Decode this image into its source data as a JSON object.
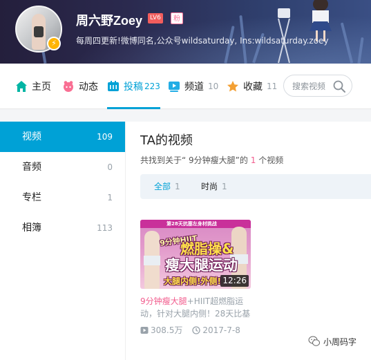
{
  "profile": {
    "name": "周六野Zoey",
    "level": "LV6",
    "fan_badge": "粉",
    "signature": "每周四更新!微博同名,公众号wildsaturday, Ins:wildsaturday.zoey"
  },
  "nav": {
    "tabs": [
      {
        "label": "主页",
        "count": "",
        "icon": "home-icon"
      },
      {
        "label": "动态",
        "count": "",
        "icon": "dynamic-icon"
      },
      {
        "label": "投稿",
        "count": "223",
        "icon": "upload-icon"
      },
      {
        "label": "频道",
        "count": "10",
        "icon": "channel-icon"
      },
      {
        "label": "收藏",
        "count": "11",
        "icon": "favorite-icon"
      }
    ],
    "active_tab": "投稿",
    "search_placeholder": "搜索视频"
  },
  "sidebar": {
    "items": [
      {
        "label": "视频",
        "count": "109"
      },
      {
        "label": "音频",
        "count": "0"
      },
      {
        "label": "专栏",
        "count": "1"
      },
      {
        "label": "相簿",
        "count": "113"
      }
    ],
    "active": "视频"
  },
  "main": {
    "title": "TA的视频",
    "result_prefix": "共找到关于“ 9分钟瘦大腿”的",
    "result_count": "1",
    "result_suffix": "个视频",
    "filters": [
      {
        "label": "全部",
        "count": "1"
      },
      {
        "label": "时尚",
        "count": "1"
      }
    ]
  },
  "video": {
    "thumb_text": {
      "banner": "第28天抗塞左身材挑战",
      "line1": "9分钟HIIT",
      "line2": "燃脂操&",
      "line3": "瘦大腿运动",
      "line4": "大腿内侧!外侧!"
    },
    "duration": "12:26",
    "title_keyword": "9分钟瘦大腿",
    "title_rest": "+HIIT超燃脂运动，针对大腿内侧！28天比基",
    "plays": "308.5万",
    "date": "2017-7-8"
  },
  "watermark": {
    "text": "小周码字"
  },
  "colors": {
    "accent": "#00a1d6",
    "highlight": "#f25d8e"
  }
}
